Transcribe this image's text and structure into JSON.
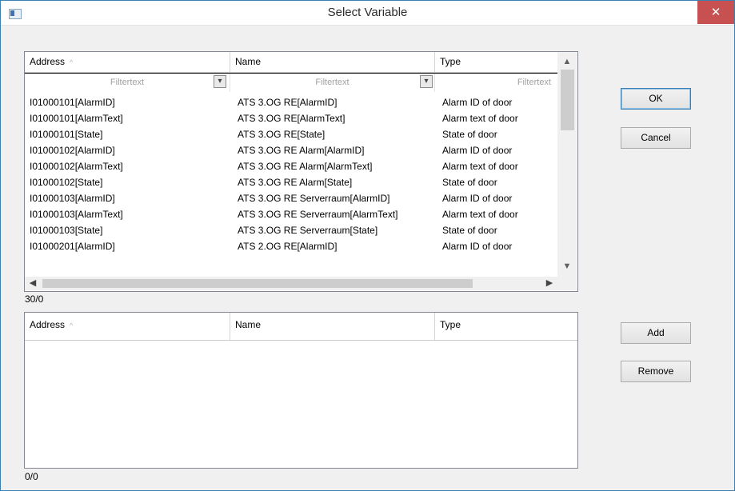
{
  "window": {
    "title": "Select Variable",
    "close_glyph": "✕"
  },
  "top_grid": {
    "columns": [
      "Address",
      "Name",
      "Type"
    ],
    "sort_indicator": "^",
    "filter_placeholder": "Filtertext",
    "rows": [
      [
        "I01000101[AlarmID]",
        "ATS 3.OG RE[AlarmID]",
        "Alarm ID of door"
      ],
      [
        "I01000101[AlarmText]",
        "ATS 3.OG RE[AlarmText]",
        "Alarm text of door"
      ],
      [
        "I01000101[State]",
        "ATS 3.OG RE[State]",
        "State of door"
      ],
      [
        "I01000102[AlarmID]",
        "ATS 3.OG RE Alarm[AlarmID]",
        "Alarm ID of door"
      ],
      [
        "I01000102[AlarmText]",
        "ATS 3.OG RE Alarm[AlarmText]",
        "Alarm text of door"
      ],
      [
        "I01000102[State]",
        "ATS 3.OG RE Alarm[State]",
        "State of door"
      ],
      [
        "I01000103[AlarmID]",
        "ATS 3.OG RE Serverraum[AlarmID]",
        "Alarm ID of door"
      ],
      [
        "I01000103[AlarmText]",
        "ATS 3.OG RE Serverraum[AlarmText]",
        "Alarm text of door"
      ],
      [
        "I01000103[State]",
        "ATS 3.OG RE Serverraum[State]",
        "State of door"
      ],
      [
        "I01000201[AlarmID]",
        "ATS 2.OG RE[AlarmID]",
        "Alarm ID of door"
      ]
    ],
    "count": "30/0"
  },
  "bottom_grid": {
    "columns": [
      "Address",
      "Name",
      "Type"
    ],
    "sort_indicator": "^",
    "rows": [],
    "count": "0/0"
  },
  "buttons": {
    "ok": "OK",
    "cancel": "Cancel",
    "add": "Add",
    "remove": "Remove"
  },
  "icons": {
    "filter": "filter-icon",
    "scroll_up": "▲",
    "scroll_down": "▼",
    "scroll_left": "◀",
    "scroll_right": "▶"
  },
  "colors": {
    "close_button": "#c75050",
    "window_border": "#3c7fb1"
  }
}
